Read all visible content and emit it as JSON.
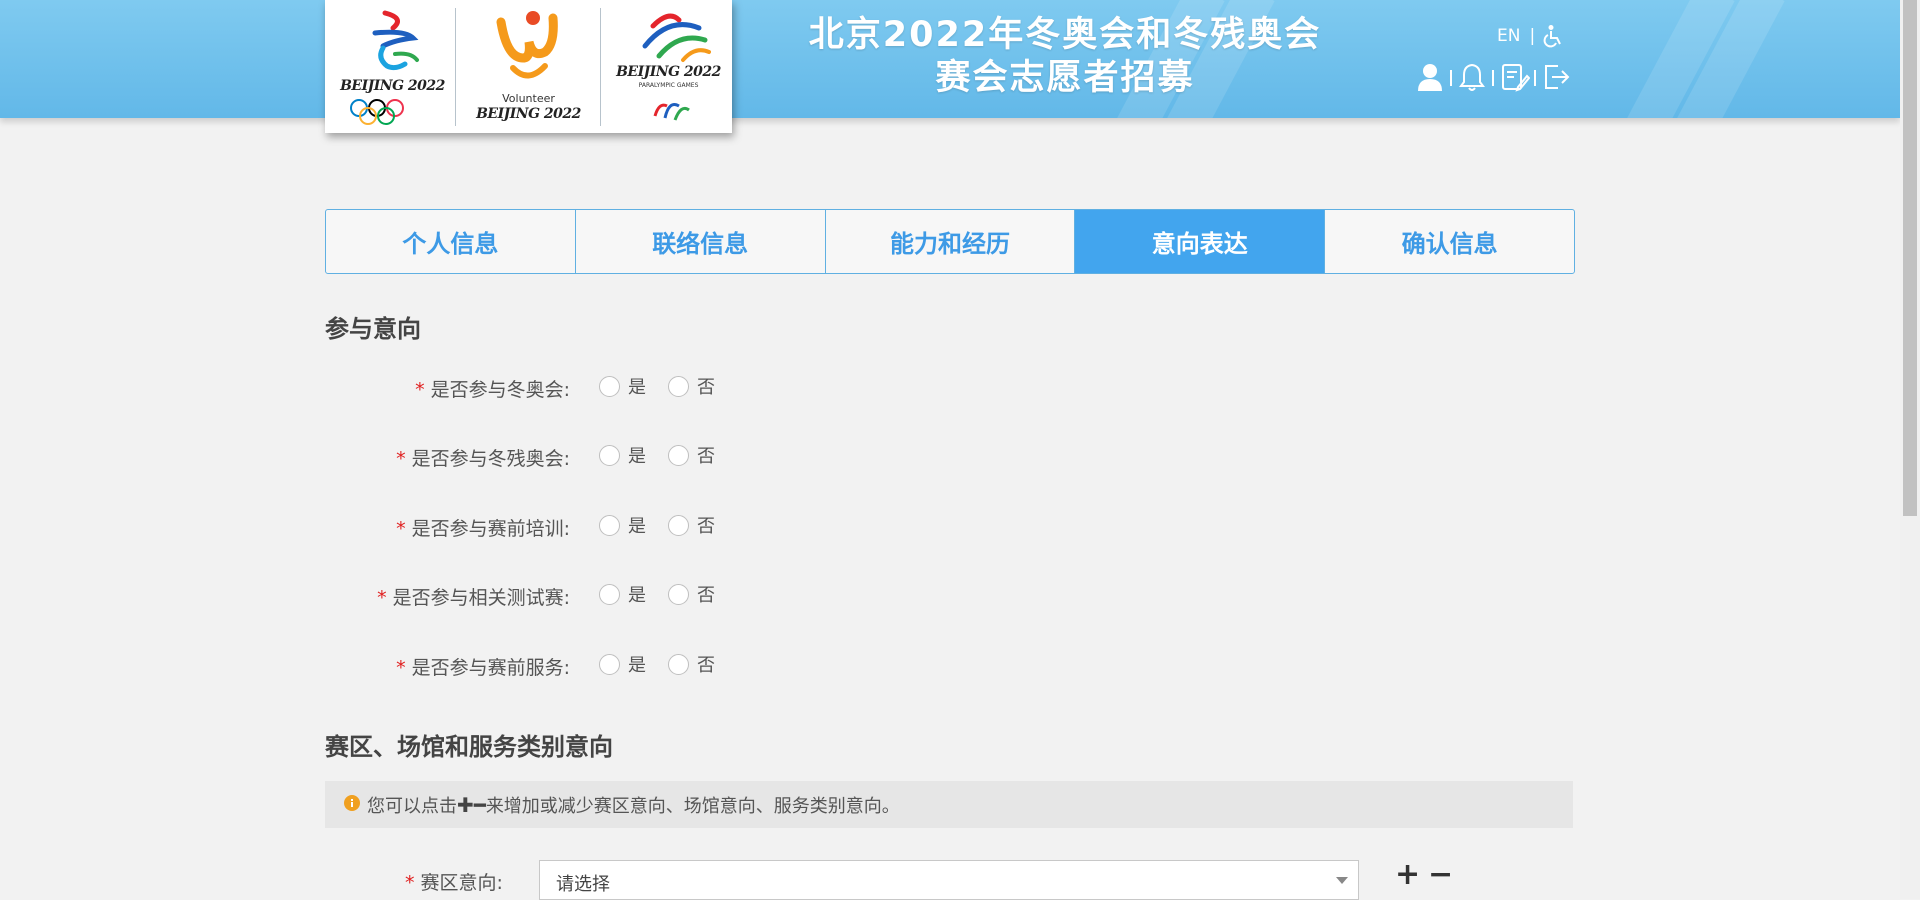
{
  "header": {
    "title_line1": "北京2022年冬奥会和冬残奥会",
    "title_line2": "赛会志愿者招募",
    "lang": "EN",
    "bg_color": "#6bbfec",
    "logos": [
      {
        "brand": "BEIJING 2022",
        "sub": ""
      },
      {
        "brand": "BEIJING 2022",
        "sub": "Volunteer"
      },
      {
        "brand": "BEIJING 2022",
        "sub": "PARALYMPIC GAMES"
      }
    ],
    "icons": [
      "accessibility-icon",
      "user-icon",
      "bell-icon",
      "edit-icon",
      "logout-icon"
    ]
  },
  "tabs": [
    {
      "label": "个人信息",
      "active": false
    },
    {
      "label": "联络信息",
      "active": false
    },
    {
      "label": "能力和经历",
      "active": false
    },
    {
      "label": "意向表达",
      "active": true
    },
    {
      "label": "确认信息",
      "active": false
    }
  ],
  "section1": {
    "title": "参与意向",
    "questions": [
      {
        "label": "是否参与冬奥会:",
        "yes": "是",
        "no": "否"
      },
      {
        "label": "是否参与冬残奥会:",
        "yes": "是",
        "no": "否"
      },
      {
        "label": "是否参与赛前培训:",
        "yes": "是",
        "no": "否"
      },
      {
        "label": "是否参与相关测试赛:",
        "yes": "是",
        "no": "否"
      },
      {
        "label": "是否参与赛前服务:",
        "yes": "是",
        "no": "否"
      }
    ]
  },
  "section2": {
    "title": "赛区、场馆和服务类别意向",
    "tip_pre": "您可以点击",
    "tip_plus": "✚",
    "tip_minus": "━",
    "tip_post": "来增加或减少赛区意向、场馆意向、服务类别意向。",
    "zone_label": "赛区意向:",
    "zone_value": "请选择",
    "add": "+",
    "remove": "−"
  },
  "colors": {
    "accent": "#42a5ee",
    "required": "#e02020",
    "info": "#f0a020"
  }
}
